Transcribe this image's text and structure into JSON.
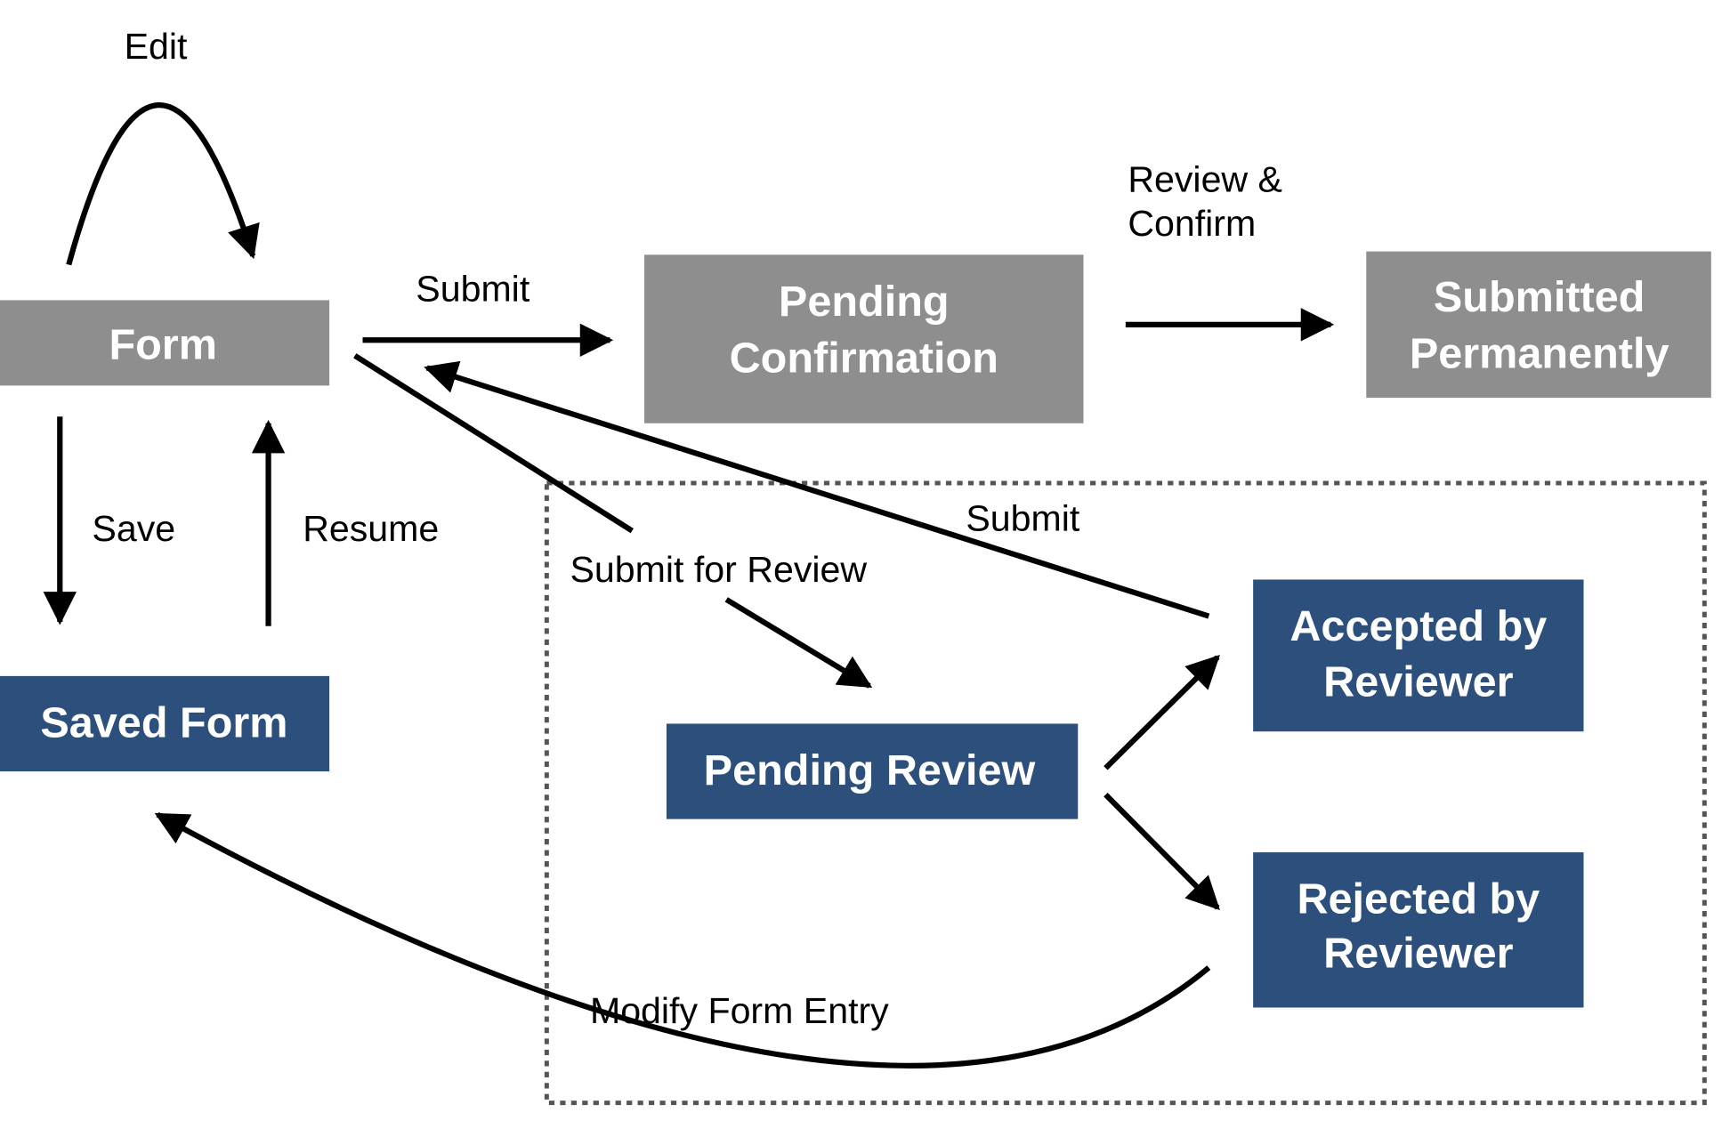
{
  "colors": {
    "state_gray": "#8e8e8e",
    "state_blue": "#2c4f7c",
    "edge": "#000000"
  },
  "nodes": {
    "form": [
      "Form"
    ],
    "pending_confirmation": [
      "Pending",
      "Confirmation"
    ],
    "submitted_permanently": [
      "Submitted",
      "Permanently"
    ],
    "saved_form": [
      "Saved Form"
    ],
    "pending_review": [
      "Pending Review"
    ],
    "accepted": [
      "Accepted by",
      "Reviewer"
    ],
    "rejected": [
      "Rejected by",
      "Reviewer"
    ]
  },
  "edges": {
    "edit": "Edit",
    "submit": "Submit",
    "review_confirm": [
      "Review &",
      "Confirm"
    ],
    "save": "Save",
    "resume": "Resume",
    "submit_for_review": "Submit for Review",
    "submit_accepted": "Submit",
    "modify": "Modify Form Entry"
  }
}
